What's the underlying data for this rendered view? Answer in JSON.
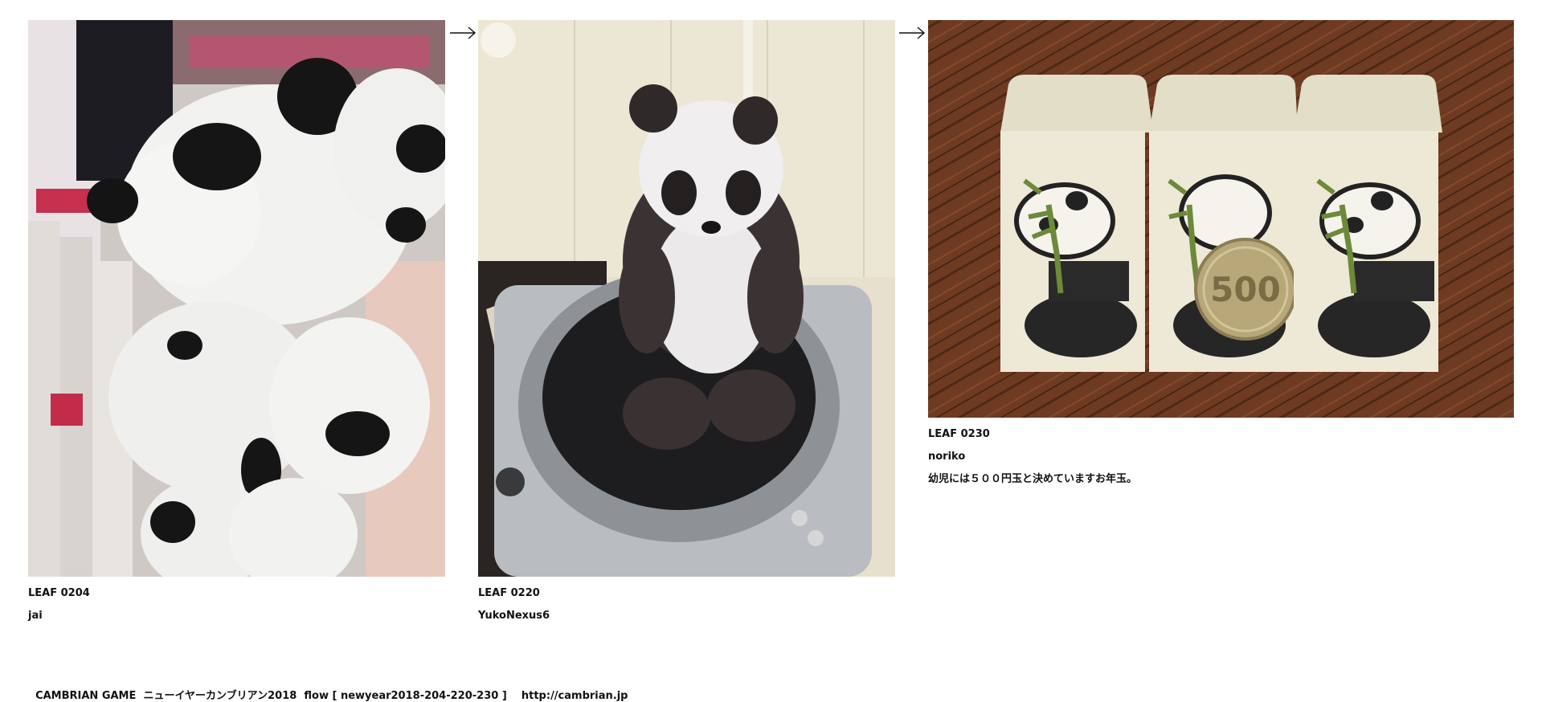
{
  "leaves": [
    {
      "id": "LEAF 0204",
      "author": "jai",
      "comment": "",
      "image_alt": "Panda plush hats hanging on a store display"
    },
    {
      "id": "LEAF 0220",
      "author": "YukoNexus6",
      "comment": "",
      "image_alt": "Panda stuffed toy sitting on a turntable"
    },
    {
      "id": "LEAF 0230",
      "author": "noriko",
      "comment": "幼児には５００円玉と決めていますお年玉。",
      "image_alt": "Three panda envelopes with a 500 yen coin on a wooden table"
    }
  ],
  "footer": {
    "game": "CAMBRIAN GAME",
    "title": "ニューイヤーカンブリアン2018",
    "flow": "flow [ newyear2018-204-220-230 ]",
    "url": "http://cambrian.jp"
  },
  "icons": {
    "arrow": "right-arrow-icon"
  },
  "colors": {
    "text": "#111111",
    "background": "#ffffff",
    "wood": "#6b3a22",
    "envelope": "#eee9d6",
    "panda_black": "#1c1c1c",
    "plush_white": "#f2f2f0",
    "bamboo": "#6c8a3a"
  }
}
